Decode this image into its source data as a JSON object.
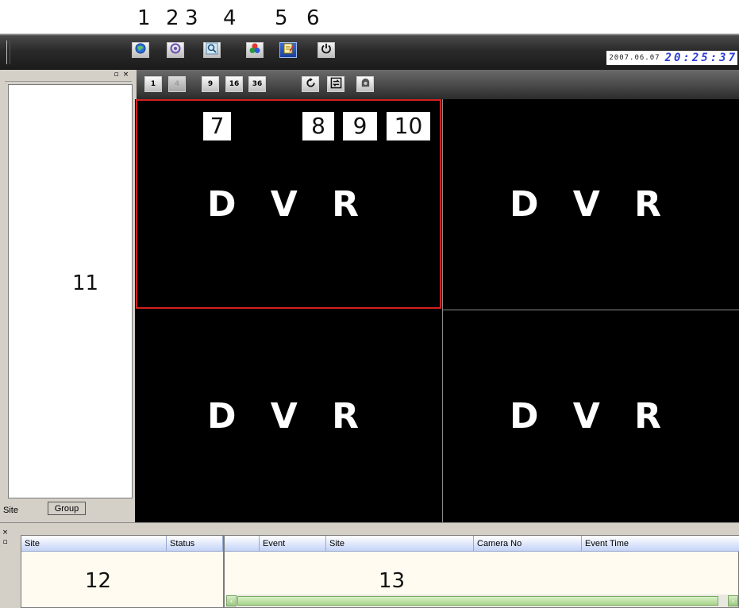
{
  "callouts": {
    "top": [
      "1",
      "2",
      "3",
      "4",
      "5",
      "6"
    ],
    "view": [
      "7",
      "8",
      "9",
      "10"
    ],
    "panel_left": "11",
    "panel_site_list": "12",
    "panel_event_list": "13"
  },
  "toolbar": {
    "buttons": [
      {
        "icon": "globe-icon"
      },
      {
        "icon": "settings-icon"
      },
      {
        "icon": "search-icon"
      },
      {
        "icon": "color-adjust-icon"
      },
      {
        "icon": "notepad-icon"
      },
      {
        "icon": "power-icon"
      }
    ],
    "date": "2007.06.07",
    "time": "20:25:37"
  },
  "left_panel": {
    "tabs": [
      "Site",
      "Group"
    ]
  },
  "view_toolbar": {
    "layout_buttons": [
      "1",
      "4",
      "9",
      "16",
      "36"
    ],
    "action_buttons": [
      {
        "icon": "refresh-icon"
      },
      {
        "icon": "sequence-icon"
      },
      {
        "icon": "ptz-camera-icon"
      }
    ]
  },
  "video_grid": {
    "cells": [
      "D V R",
      "D V R",
      "D V R",
      "D V R"
    ],
    "selected_cell_color": "#d42020"
  },
  "bottom_panel": {
    "site_list_columns": [
      "Site",
      "Status"
    ],
    "event_list_columns": [
      "Event",
      "Site",
      "Camera No",
      "Event Time"
    ]
  }
}
